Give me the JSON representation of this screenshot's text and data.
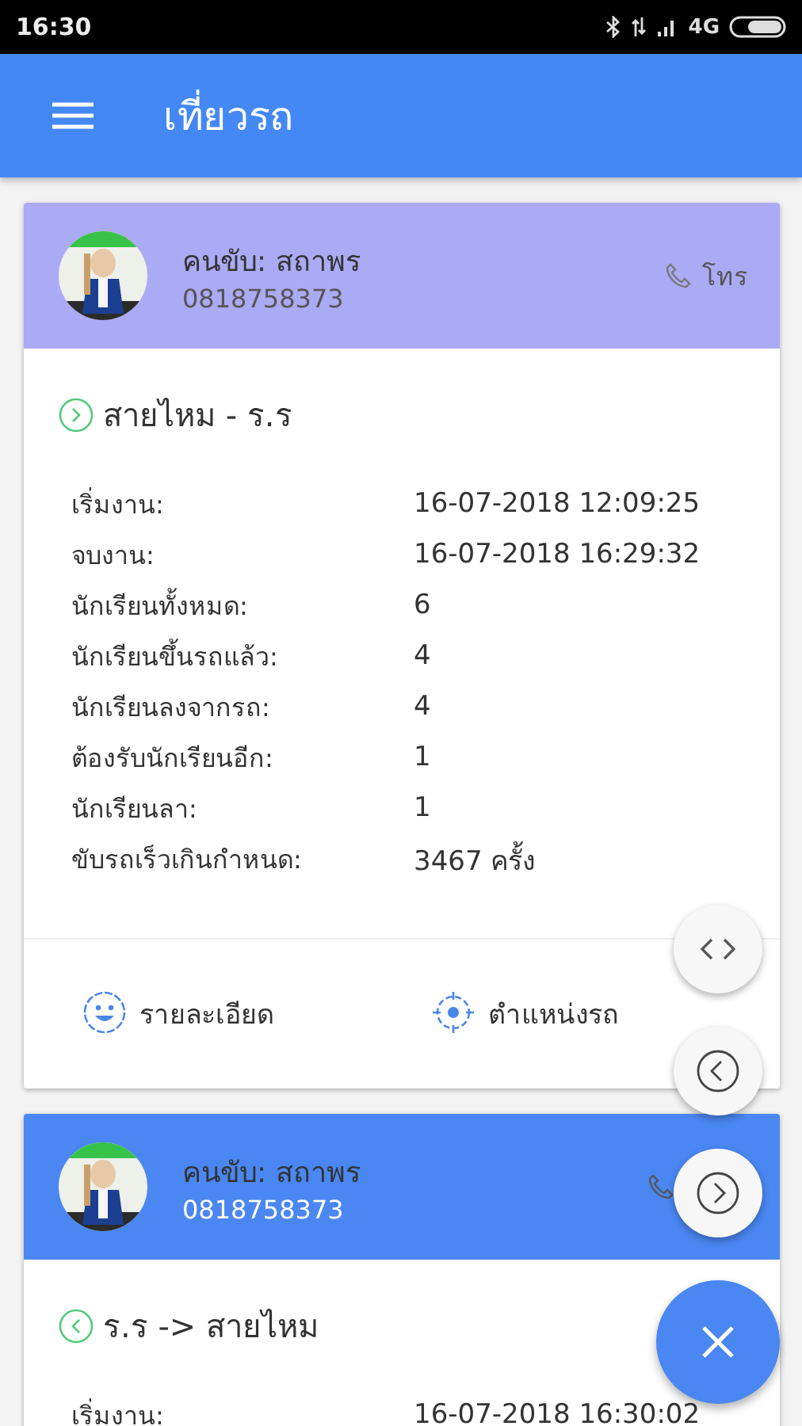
{
  "status_bar": {
    "time": "16:30",
    "network": "4G"
  },
  "app_bar": {
    "title": "เที่ยวรถ"
  },
  "trips": [
    {
      "selected": false,
      "driver": "คนขับ: สถาพร",
      "phone": "0818758373",
      "call_label": "โทร",
      "kind": "outbound",
      "route": "สายไหม - ร.ร",
      "rows": [
        {
          "label": "เริ่มงาน:",
          "value": "16-07-2018 12:09:25"
        },
        {
          "label": "จบงาน:",
          "value": "16-07-2018 16:29:32"
        },
        {
          "label": "นักเรียนทั้งหมด:",
          "value": "6"
        },
        {
          "label": "นักเรียนขึ้นรถแล้ว:",
          "value": "4"
        },
        {
          "label": "นักเรียนลงจากรถ:",
          "value": "4"
        },
        {
          "label": "ต้องรับนักเรียนอีก:",
          "value": "1"
        },
        {
          "label": "นักเรียนลา:",
          "value": "1"
        },
        {
          "label": "ขับรถเร็วเกินกำหนด:",
          "value": "3467 ครั้ง"
        }
      ],
      "actions": [
        {
          "kind": "details",
          "label": "รายละเอียด"
        },
        {
          "kind": "location",
          "label": "ตำแหน่งรถ"
        }
      ]
    },
    {
      "selected": true,
      "driver": "คนขับ: สถาพร",
      "phone": "0818758373",
      "kind": "return",
      "route": "ร.ร -> สายไหม",
      "rows": [
        {
          "label": "เริ่มงาน:",
          "value": "16-07-2018 16:30:02"
        }
      ]
    }
  ],
  "fabs": [
    {
      "kind": "code"
    },
    {
      "kind": "prev"
    },
    {
      "kind": "next"
    },
    {
      "kind": "close"
    }
  ]
}
